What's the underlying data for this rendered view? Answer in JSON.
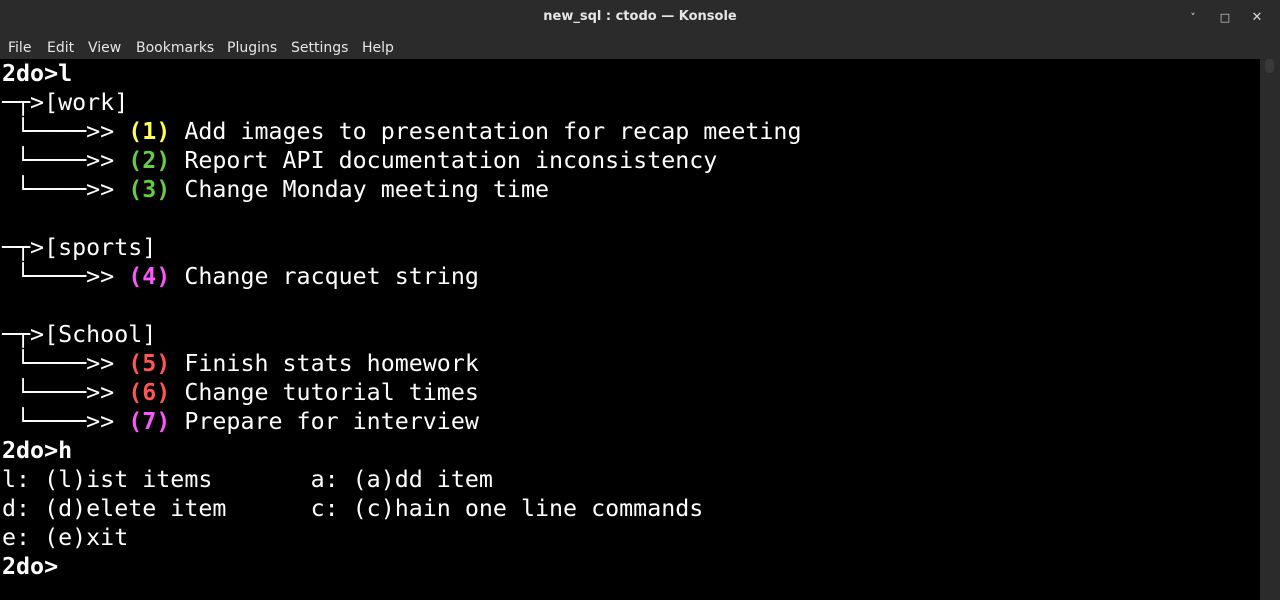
{
  "window": {
    "title": "new_sql : ctodo — Konsole",
    "minimize_icon": "˅",
    "maximize_icon": "□",
    "close_icon": "✕"
  },
  "menubar": {
    "items": [
      "File",
      "Edit",
      "View",
      "Bookmarks",
      "Plugins",
      "Settings",
      "Help"
    ]
  },
  "colors": {
    "yellow": "#ffff55",
    "green": "#66cc44",
    "magenta": "#ff55ff",
    "red": "#ff5555"
  },
  "terminal": {
    "prompt1": "2do>l",
    "group_work_branch": "─┬>",
    "group_work": "[work]",
    "work_items": [
      {
        "branch": " └────>> ",
        "num": "(1)",
        "text": " Add images to presentation for recap meeting"
      },
      {
        "branch": " └────>> ",
        "num": "(2)",
        "text": " Report API documentation inconsistency"
      },
      {
        "branch": " └────>> ",
        "num": "(3)",
        "text": " Change Monday meeting time"
      }
    ],
    "group_sports_branch": "─┬>",
    "group_sports": "[sports]",
    "sports_items": [
      {
        "branch": " └────>> ",
        "num": "(4)",
        "text": " Change racquet string"
      }
    ],
    "group_school_branch": "─┬>",
    "group_school": "[School]",
    "school_items": [
      {
        "branch": " └────>> ",
        "num": "(5)",
        "text": " Finish stats homework"
      },
      {
        "branch": " └────>> ",
        "num": "(6)",
        "text": " Change tutorial times"
      },
      {
        "branch": " └────>> ",
        "num": "(7)",
        "text": " Prepare for interview"
      }
    ],
    "prompt2": "2do>h",
    "help_lines": [
      "l: (l)ist items       a: (a)dd item",
      "d: (d)elete item      c: (c)hain one line commands",
      "e: (e)xit"
    ],
    "prompt3": "2do>"
  }
}
